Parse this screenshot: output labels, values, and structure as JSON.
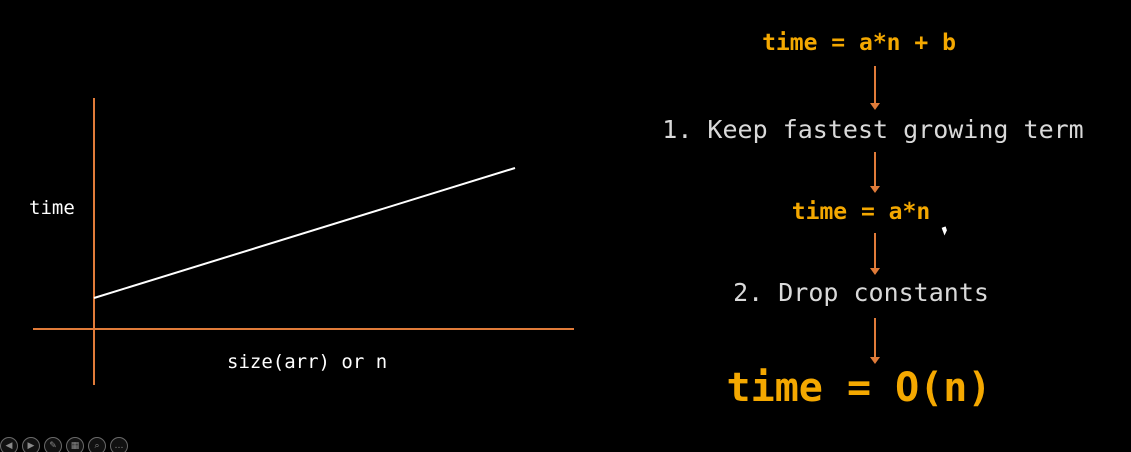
{
  "graph": {
    "y_label": "time",
    "x_label": "size(arr) or n",
    "axis_color": "#e07b39",
    "line_color": "#ffffff"
  },
  "flow": {
    "equation_1": "time = a*n + b",
    "step_1": "1. Keep fastest growing term",
    "equation_2": "time = a*n",
    "step_2": "2. Drop constants",
    "equation_final": "time = O(n)",
    "equation_color": "#f4a800",
    "arrow_color": "#e07b39"
  },
  "controls": [
    {
      "name": "previous",
      "icon": "prev-icon",
      "glyph": "◀"
    },
    {
      "name": "next",
      "icon": "next-icon",
      "glyph": "▶"
    },
    {
      "name": "pen",
      "icon": "pen-icon",
      "glyph": "✎"
    },
    {
      "name": "slides",
      "icon": "slides-icon",
      "glyph": "▦"
    },
    {
      "name": "zoom",
      "icon": "zoom-icon",
      "glyph": "⌕"
    },
    {
      "name": "more",
      "icon": "more-icon",
      "glyph": "…"
    }
  ]
}
